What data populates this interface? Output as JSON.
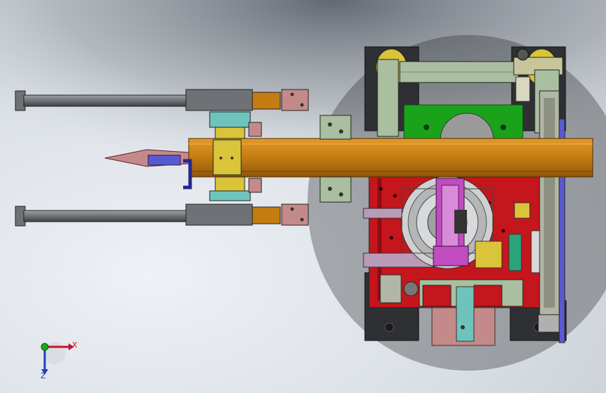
{
  "viewport": {
    "background_top": "#7c8088",
    "background_mid": "#dde2e8",
    "background_light": "#eef1f5"
  },
  "colors": {
    "frame_red": "#c4161c",
    "dark_base": "#2f3033",
    "sage_frame": "#a9bfa0",
    "green_plate": "#1aa31a",
    "gold_beam": "#c47c12",
    "yellow_block": "#d9c43a",
    "cylinder_grey": "#6e7276",
    "rose_block": "#c48a8a",
    "teal_block": "#6ec4bc",
    "magenta_bracket": "#c04cc0",
    "navy_clamp": "#26268c",
    "slate_guide": "#5a5ad0"
  },
  "triad": {
    "x_label": "X",
    "z_label": "Z",
    "x_color": "#c8102e",
    "z_color": "#1f3fbf",
    "origin_color": "#18a818"
  }
}
